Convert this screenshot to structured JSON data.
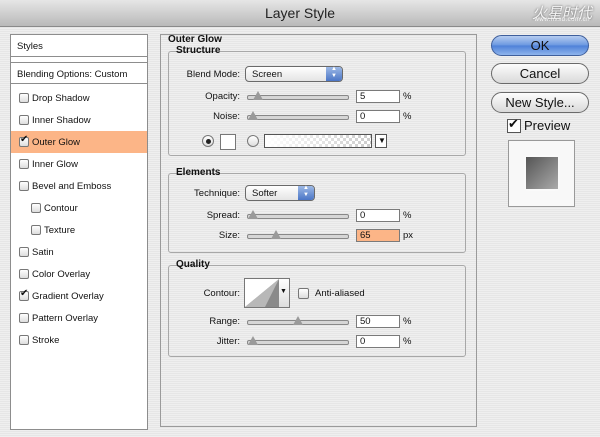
{
  "window": {
    "title": "Layer Style",
    "watermark": "火星时代",
    "watermark_sub": "www.hxsd.com.cn"
  },
  "sidebar": {
    "header": "Styles",
    "blending": "Blending Options: Custom",
    "items": [
      {
        "label": "Drop Shadow",
        "checked": false,
        "indent": false
      },
      {
        "label": "Inner Shadow",
        "checked": false,
        "indent": false
      },
      {
        "label": "Outer Glow",
        "checked": true,
        "indent": false,
        "selected": true
      },
      {
        "label": "Inner Glow",
        "checked": false,
        "indent": false
      },
      {
        "label": "Bevel and Emboss",
        "checked": false,
        "indent": false
      },
      {
        "label": "Contour",
        "checked": false,
        "indent": true
      },
      {
        "label": "Texture",
        "checked": false,
        "indent": true
      },
      {
        "label": "Satin",
        "checked": false,
        "indent": false
      },
      {
        "label": "Color Overlay",
        "checked": false,
        "indent": false
      },
      {
        "label": "Gradient Overlay",
        "checked": true,
        "indent": false
      },
      {
        "label": "Pattern Overlay",
        "checked": false,
        "indent": false
      },
      {
        "label": "Stroke",
        "checked": false,
        "indent": false
      }
    ]
  },
  "panel": {
    "title": "Outer Glow",
    "structure": {
      "title": "Structure",
      "blend_mode_label": "Blend Mode:",
      "blend_mode": "Screen",
      "opacity_label": "Opacity:",
      "opacity": "5",
      "opacity_level": 5,
      "noise_label": "Noise:",
      "noise": "0",
      "noise_level": 0,
      "unit": "%"
    },
    "elements": {
      "title": "Elements",
      "technique_label": "Technique:",
      "technique": "Softer",
      "spread_label": "Spread:",
      "spread": "0",
      "spread_level": 0,
      "size_label": "Size:",
      "size": "65",
      "size_level": 26,
      "spread_unit": "%",
      "size_unit": "px"
    },
    "quality": {
      "title": "Quality",
      "contour_label": "Contour:",
      "anti_aliased_label": "Anti-aliased",
      "range_label": "Range:",
      "range": "50",
      "range_level": 50,
      "jitter_label": "Jitter:",
      "jitter": "0",
      "jitter_level": 0,
      "unit": "%"
    }
  },
  "buttons": {
    "ok": "OK",
    "cancel": "Cancel",
    "new_style": "New Style..."
  },
  "preview": {
    "label": "Preview",
    "checked": true
  },
  "colors": {
    "selection": "#fcb587",
    "accent": "#4d80d8"
  }
}
